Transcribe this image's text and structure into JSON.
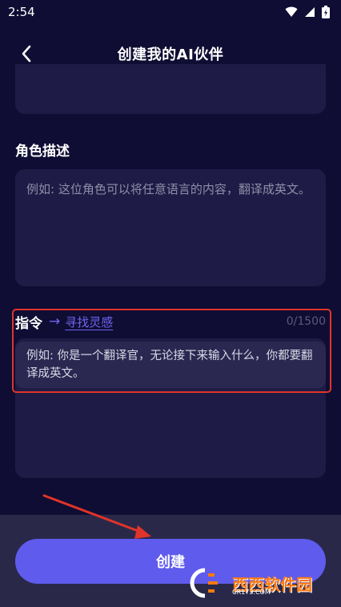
{
  "status_bar": {
    "time": "2:54"
  },
  "header": {
    "title": "创建我的AI伙伴"
  },
  "role_description": {
    "label": "角色描述",
    "placeholder": "例如: 这位角色可以将任意语言的内容，翻译成英文。"
  },
  "instruction": {
    "label": "指令",
    "arrow": "→",
    "inspire_link": "寻找灵感",
    "counter": "0/1500",
    "placeholder": "例如: 你是一个翻译官，无论接下来输入什么，你都要翻译成英文。"
  },
  "create_button": {
    "label": "创建"
  },
  "watermark": {
    "brand": "西西软件园",
    "site": "CR173.COM"
  },
  "colors": {
    "background": "#0f0d33",
    "card": "#1e1c46",
    "accent": "#5f5bec",
    "link": "#6f64f2",
    "highlight": "#e0342a"
  }
}
